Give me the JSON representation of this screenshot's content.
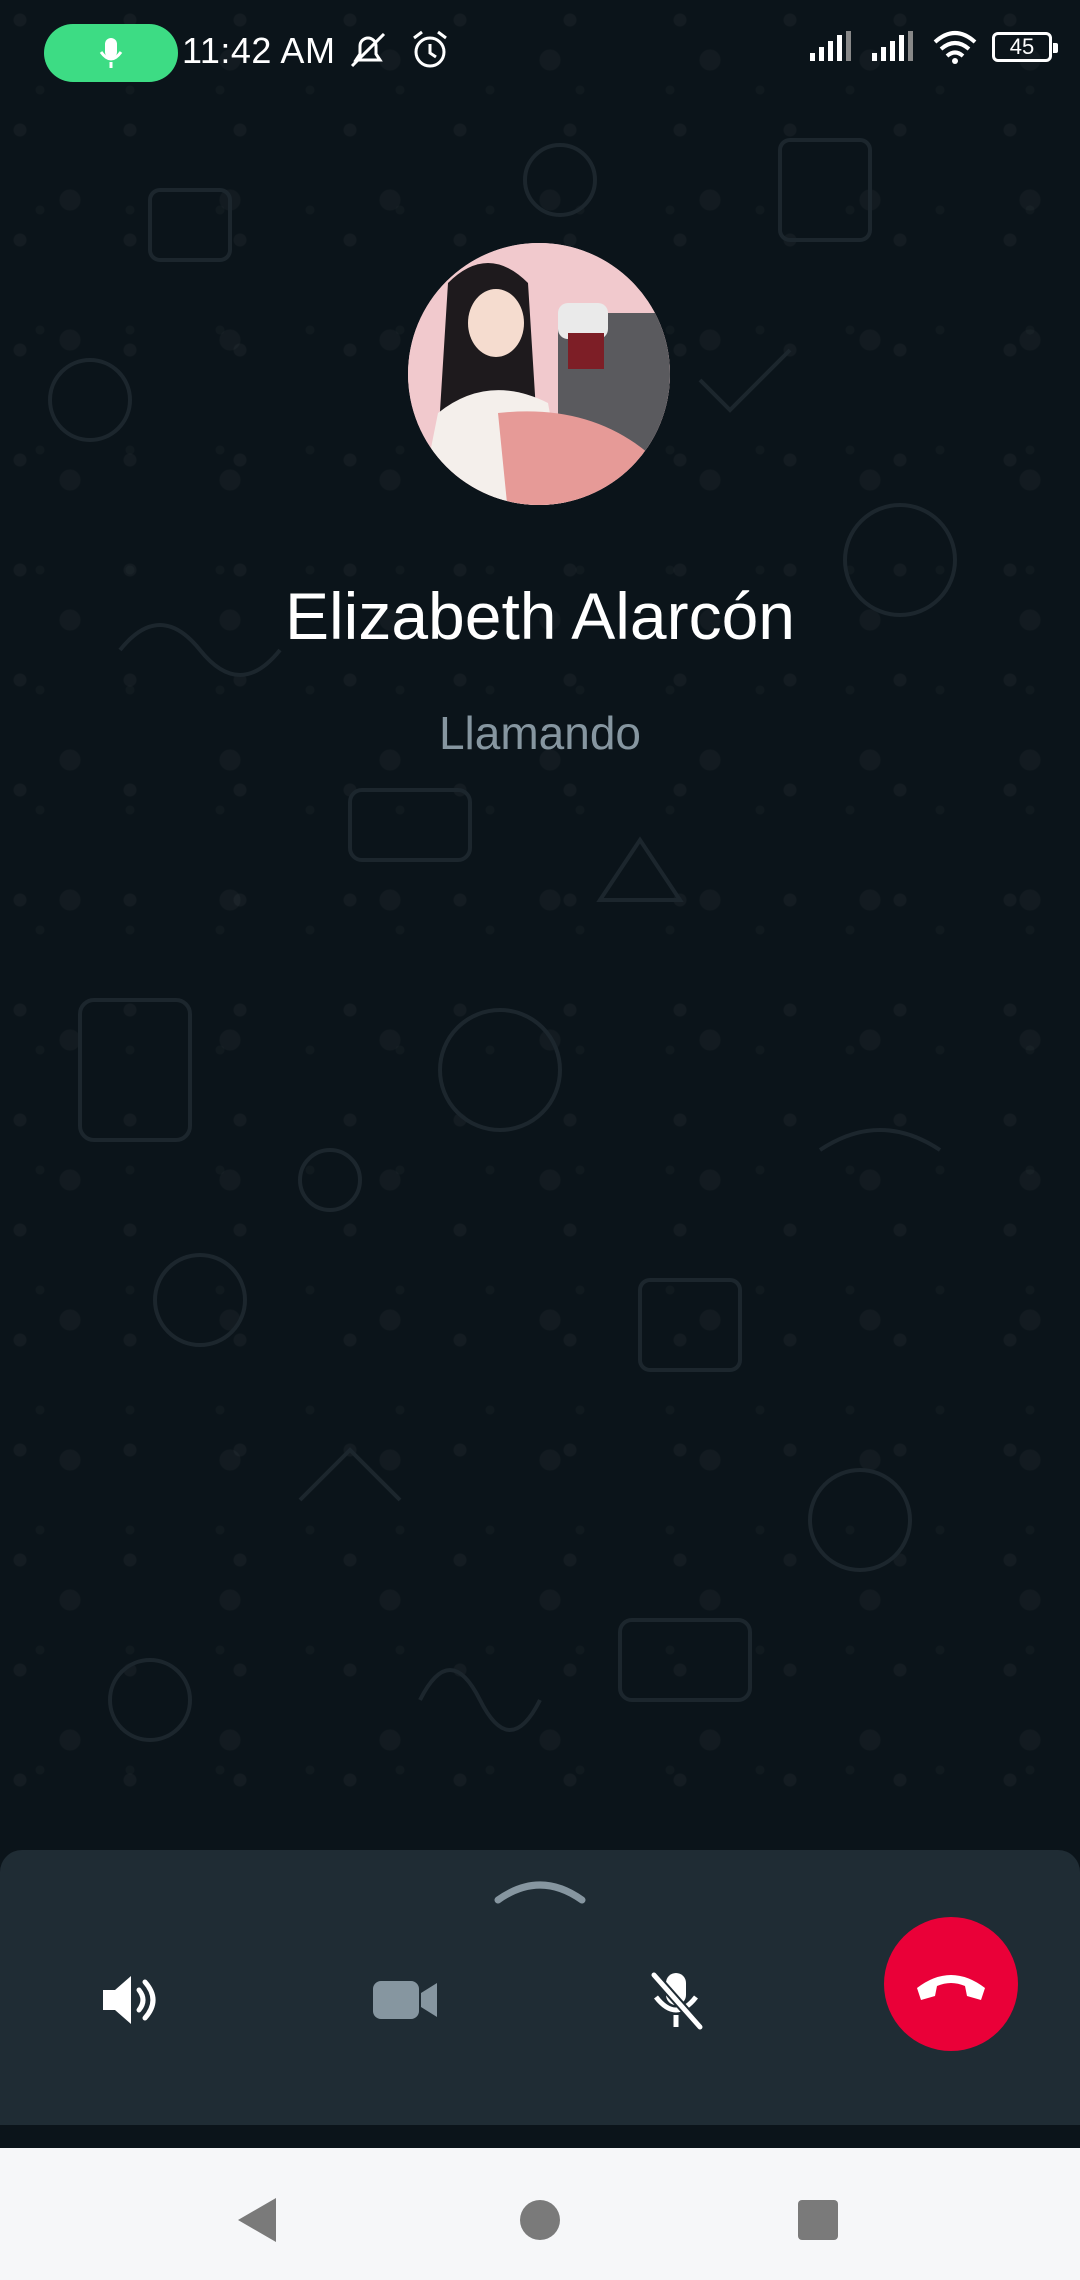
{
  "status_bar": {
    "time": "11:42 AM",
    "battery": "45",
    "icons": [
      "mic-active-icon",
      "notifications-off-icon",
      "alarm-icon",
      "signal-icon",
      "signal-icon",
      "wifi-icon",
      "battery-icon"
    ]
  },
  "call": {
    "contact_name": "Elizabeth Alarcón",
    "status": "Llamando"
  },
  "controls": {
    "expand_icon": "chevron-up-icon",
    "speaker_icon": "speaker-icon",
    "video_icon": "video-camera-icon",
    "mute_icon": "mic-off-icon",
    "end_call_icon": "end-call-icon",
    "end_call_color": "#ea0038"
  },
  "nav_bar": {
    "back_icon": "back-icon",
    "home_icon": "home-icon",
    "recents_icon": "recents-icon"
  },
  "colors": {
    "background": "#0b141a",
    "panel": "#1f2c34",
    "mic_pill": "#3ddc84"
  }
}
